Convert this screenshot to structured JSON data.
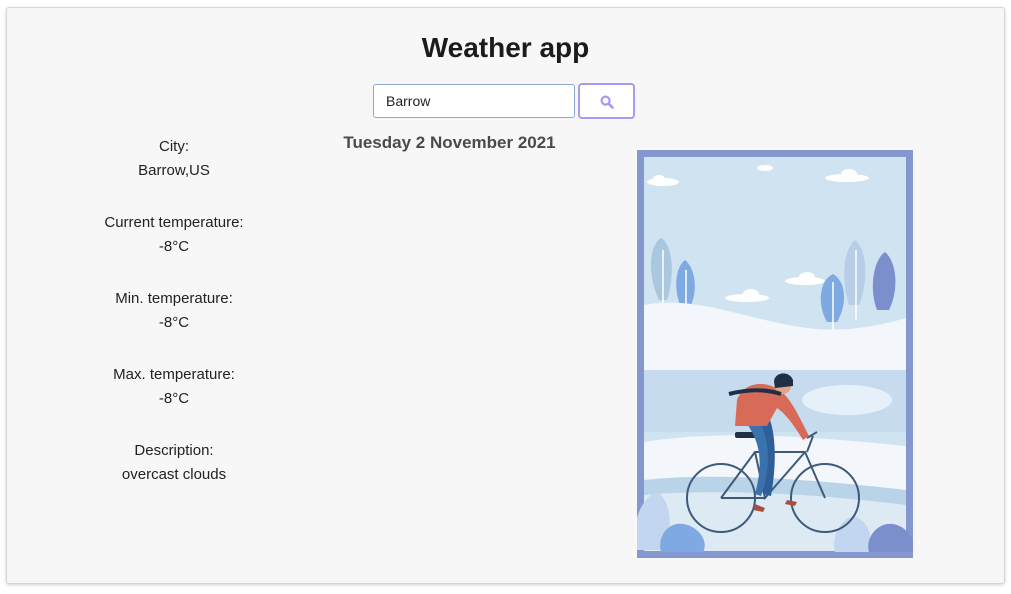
{
  "app": {
    "title": "Weather app"
  },
  "search": {
    "value": "Barrow",
    "button_icon": "search-icon"
  },
  "date": "Tuesday 2 November 2021",
  "weather": {
    "city_label": "City:",
    "city_value": "Barrow,US",
    "current_label": "Current temperature:",
    "current_value": "-8°C",
    "min_label": "Min. temperature:",
    "min_value": "-8°C",
    "max_label": "Max. temperature:",
    "max_value": "-8°C",
    "description_label": "Description:",
    "description_value": "overcast clouds"
  },
  "colors": {
    "accent": "#a79bf2",
    "frame": "#8497cf",
    "sky": "#cfe3f1"
  }
}
